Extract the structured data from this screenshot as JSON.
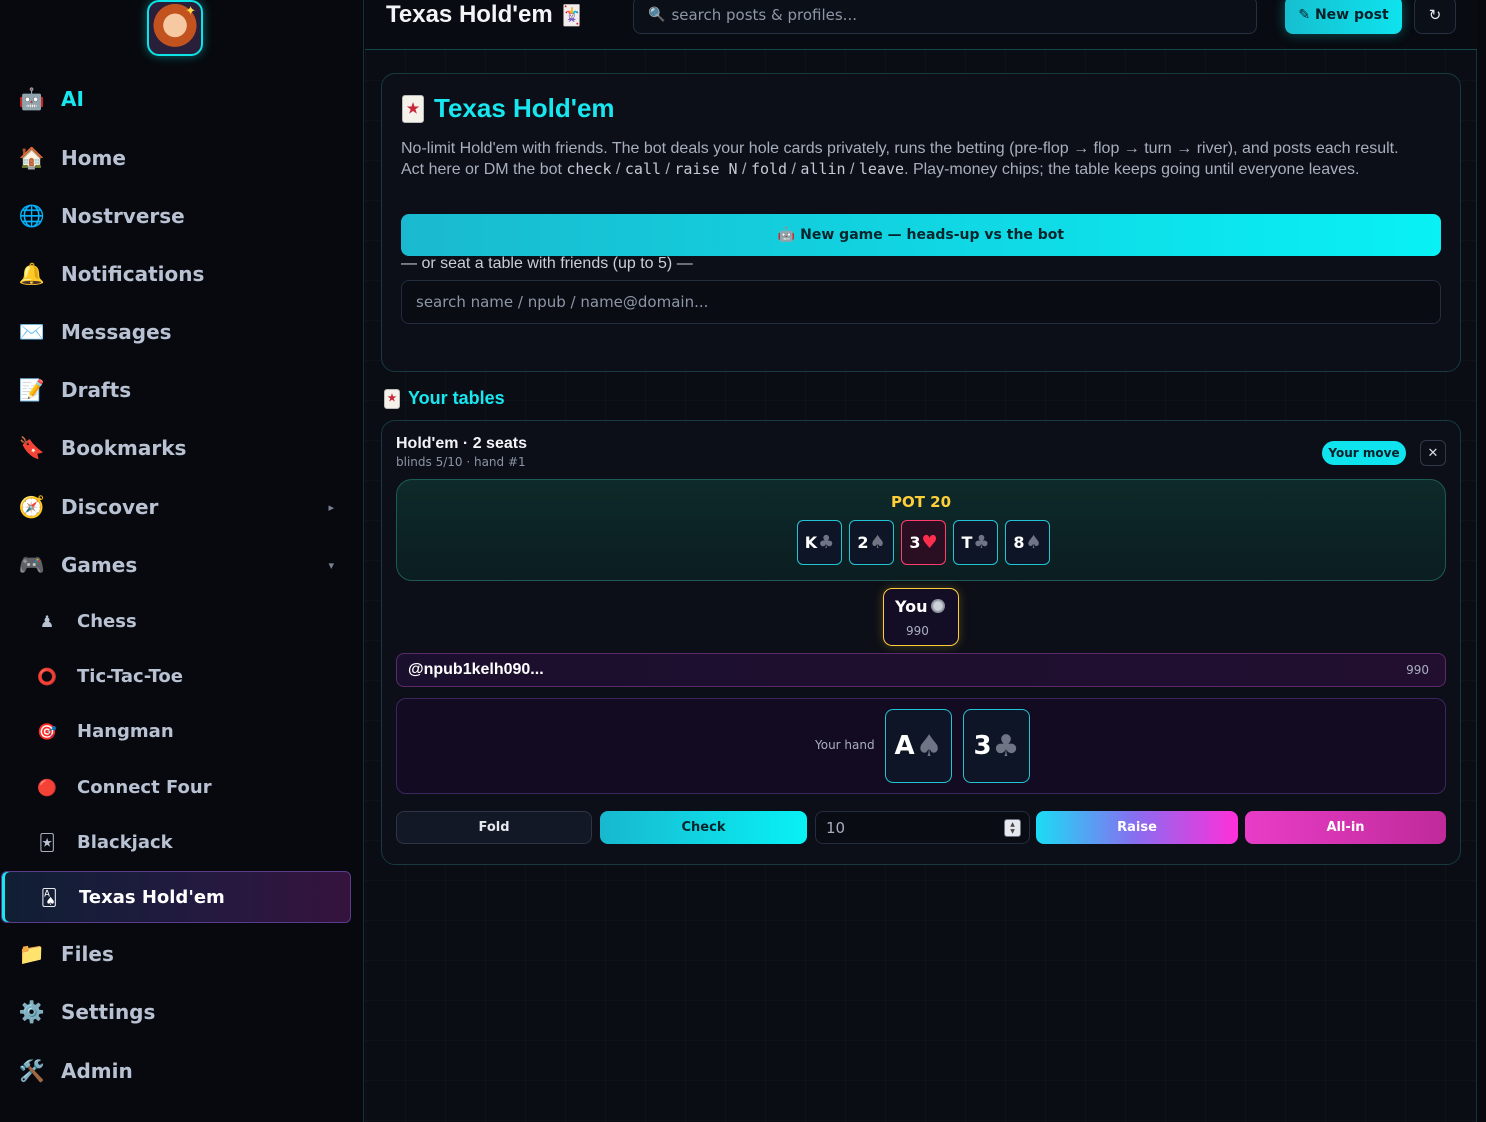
{
  "sidebar": {
    "items": [
      {
        "label": "AI",
        "icon": "robot-icon"
      },
      {
        "label": "Home",
        "icon": "home-icon"
      },
      {
        "label": "Nostrverse",
        "icon": "globe-icon"
      },
      {
        "label": "Notifications",
        "icon": "bell-icon"
      },
      {
        "label": "Messages",
        "icon": "envelope-icon"
      },
      {
        "label": "Drafts",
        "icon": "memo-icon"
      },
      {
        "label": "Bookmarks",
        "icon": "bookmark-icon"
      },
      {
        "label": "Discover",
        "icon": "compass-icon"
      },
      {
        "label": "Games",
        "icon": "gamepad-icon"
      },
      {
        "label": "Files",
        "icon": "folder-icon"
      },
      {
        "label": "Settings",
        "icon": "gear-icon"
      },
      {
        "label": "Admin",
        "icon": "tools-icon"
      }
    ],
    "games": [
      {
        "label": "Chess",
        "icon": "chess-pawn-icon"
      },
      {
        "label": "Tic-Tac-Toe",
        "icon": "circle-icon"
      },
      {
        "label": "Hangman",
        "icon": "target-icon"
      },
      {
        "label": "Connect Four",
        "icon": "red-disc-icon"
      },
      {
        "label": "Blackjack",
        "icon": "joker-card-icon"
      },
      {
        "label": "Texas Hold'em",
        "icon": "playing-card-icon"
      }
    ]
  },
  "header": {
    "title": "Texas Hold'em",
    "search_placeholder": "search posts & profiles...",
    "new_post": "✎ New post",
    "refresh": "↻"
  },
  "intro": {
    "title": "Texas Hold'em",
    "desc_part1": "No-limit Hold'em with friends. The bot deals your hole cards privately, runs the betting (pre-flop → flop → turn → river), and posts each result. Act here or DM the bot ",
    "cmd_check": "check",
    "cmd_call": "call",
    "cmd_raise": "raise N",
    "cmd_fold": "fold",
    "cmd_allin": "allin",
    "cmd_leave": "leave",
    "sep": " / ",
    "desc_part2": ". Play-money chips; the table keeps going until everyone leaves.",
    "new_game": "🤖 New game — heads-up vs the bot",
    "seat_label": "— or seat a table with friends (up to 5) —",
    "friend_placeholder": "search name / npub / name@domain..."
  },
  "tables": {
    "heading": "Your tables",
    "table": {
      "title": "Hold'em · 2 seats",
      "subtitle": "blinds 5/10 · hand #1",
      "badge": "Your move",
      "close": "✕",
      "pot": "POT 20",
      "board": [
        {
          "rank": "K",
          "suit": "♣",
          "red": false
        },
        {
          "rank": "2",
          "suit": "♠",
          "red": false
        },
        {
          "rank": "3",
          "suit": "♥",
          "red": true
        },
        {
          "rank": "T",
          "suit": "♣",
          "red": false
        },
        {
          "rank": "8",
          "suit": "♠",
          "red": false
        }
      ],
      "you_label": "You",
      "you_chips": "990",
      "opponent": "@npub1kelh090...",
      "opponent_chips": "990",
      "hand_label": "Your hand",
      "hand": [
        {
          "rank": "A",
          "suit": "♠"
        },
        {
          "rank": "3",
          "suit": "♣"
        }
      ],
      "actions": {
        "fold": "Fold",
        "check": "Check",
        "raise_value": "10",
        "raise": "Raise",
        "allin": "All-in"
      }
    }
  }
}
